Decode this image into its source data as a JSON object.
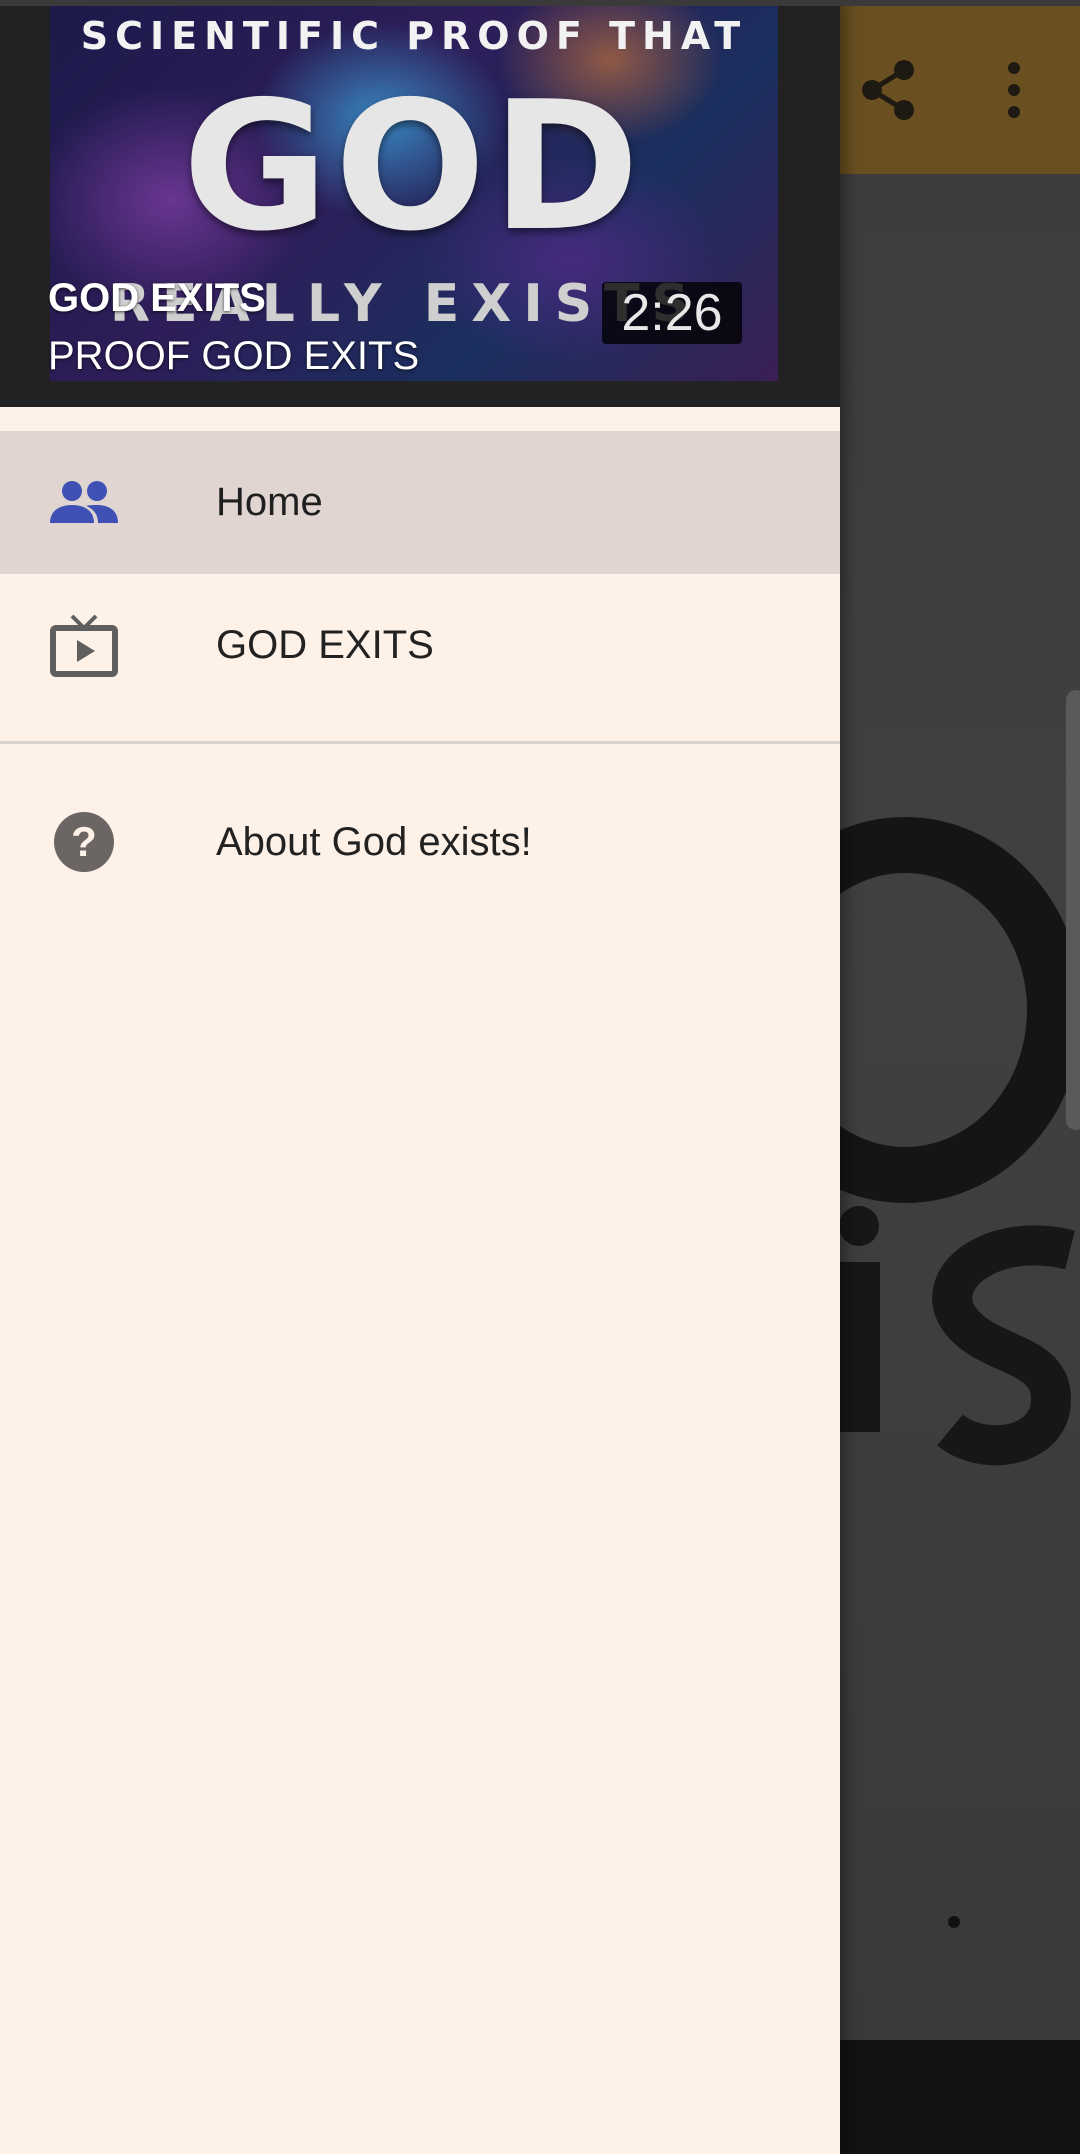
{
  "header": {
    "thumbnail": {
      "line1": "SCIENTIFIC PROOF THAT",
      "line2": "GOD",
      "line3": "REALLY EXISTS",
      "duration": "2:26"
    },
    "title": "GOD EXITS",
    "subtitle": "PROOF GOD EXITS"
  },
  "menu": {
    "items": [
      {
        "label": "Home",
        "icon": "people-icon",
        "selected": true,
        "icon_color": "#3f51b5"
      },
      {
        "label": "GOD EXITS",
        "icon": "tv-play-icon",
        "selected": false,
        "icon_color": "#5f5f5f"
      }
    ],
    "secondary": [
      {
        "label": "About God exists!",
        "icon": "help-circle-icon",
        "icon_color": "#6b6563"
      }
    ]
  },
  "toolbar": {
    "actions": [
      "share-icon",
      "more-vert-icon"
    ]
  },
  "colors": {
    "drawer_bg": "#fdf1e8",
    "selected_bg": "#e0d5d0",
    "toolbar_bg": "#6a5020",
    "accent": "#3f51b5"
  }
}
